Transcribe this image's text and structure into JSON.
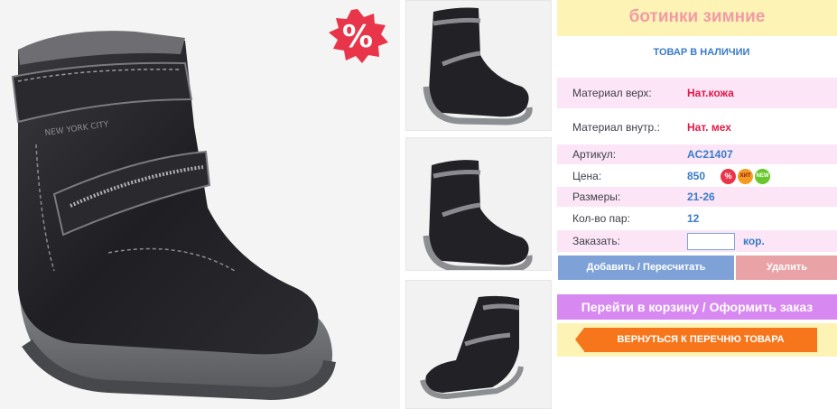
{
  "product": {
    "title": "ботинки зимние",
    "availability": "ТОВАР В НАЛИЧИИ",
    "sale_badge": "%"
  },
  "specs": {
    "material_top_label": "Материал верх:",
    "material_top_value": "Нат.кожа",
    "material_in_label": "Материал внутр.:",
    "material_in_value": "Нат. мех",
    "article_label": "Артикул:",
    "article_value": "AC21407",
    "price_label": "Цена:",
    "price_value": "850",
    "sizes_label": "Размеры:",
    "sizes_value": "21-26",
    "pairs_label": "Кол-во пар:",
    "pairs_value": "12",
    "order_label": "Заказать:",
    "order_value": "",
    "order_unit": "кор."
  },
  "badges": {
    "sale": "%",
    "hit": "ХИТ",
    "new": "NEW"
  },
  "buttons": {
    "add": "Добавить / Пересчитать",
    "delete": "Удалить",
    "cart": "Перейти в корзину / Оформить заказ",
    "back": "ВЕРНУТЬСЯ К ПЕРЕЧНЮ ТОВАРА"
  },
  "main_image_text": "NEW YORK CITY",
  "icons": {
    "main": "boot-photo",
    "thumb1": "boot-thumbnail",
    "thumb2": "boot-thumbnail",
    "thumb3": "boot-thumbnail"
  },
  "colors": {
    "title_bg": "#fdf3b5",
    "title_text": "#f29aa6",
    "accent_blue": "#3a7bc8",
    "spec_row_bg": "#fbe5f7",
    "add_button": "#7ea2d8",
    "delete_button": "#e9a3a6",
    "cart_button": "#d889f1",
    "back_button": "#f7761c",
    "sale_badge": "#e8354a"
  }
}
